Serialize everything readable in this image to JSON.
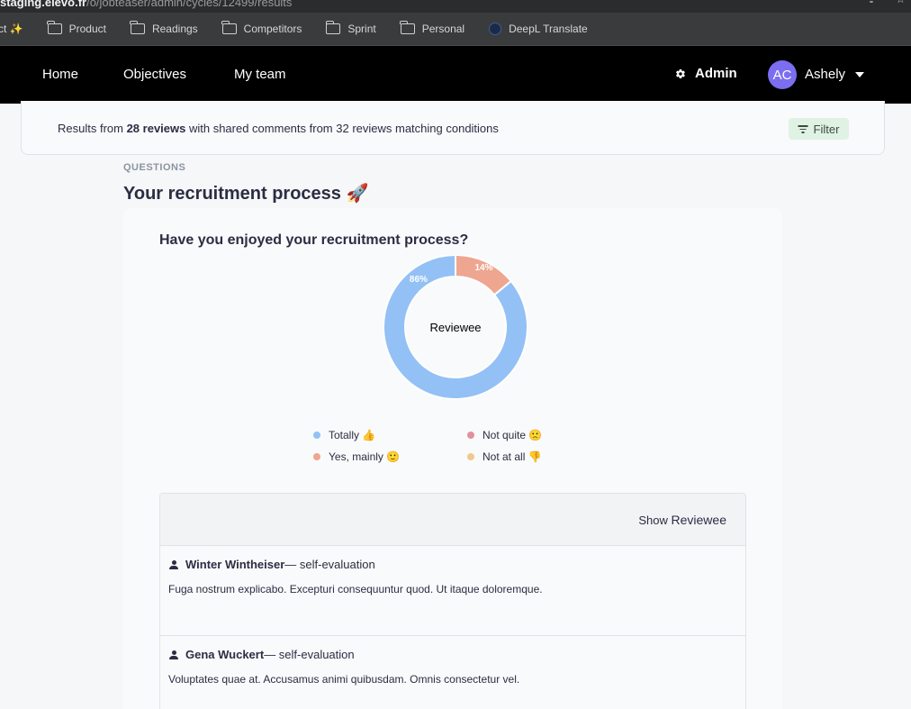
{
  "browser": {
    "url_host": "staging.elevo.fr",
    "url_path": "/o/jobteaser/admin/cycles/12499/results",
    "bookmarks": [
      {
        "label": "ct ✨",
        "icon": "sparkle"
      },
      {
        "label": "Product",
        "icon": "folder-icon"
      },
      {
        "label": "Readings",
        "icon": "folder-icon"
      },
      {
        "label": "Competitors",
        "icon": "folder-icon"
      },
      {
        "label": "Sprint",
        "icon": "folder-icon"
      },
      {
        "label": "Personal",
        "icon": "folder-icon"
      },
      {
        "label": "DeepL Translate",
        "icon": "deepl-icon"
      }
    ]
  },
  "nav": {
    "home": "Home",
    "objectives": "Objectives",
    "my_team": "My team",
    "admin": "Admin",
    "avatar_initials": "AC",
    "user_name": "Ashely"
  },
  "banner": {
    "prefix": "Results from ",
    "reviews_count": "28 reviews",
    "suffix": " with shared comments from 32 reviews matching conditions",
    "filter_label": "Filter"
  },
  "section": {
    "label": "QUESTIONS",
    "title": "Your recruitment process 🚀"
  },
  "question": {
    "title": "Have you enjoyed your recruitment process?",
    "center_label": "Reviewee"
  },
  "chart_data": {
    "type": "pie",
    "categories": [
      "Totally 👍",
      "Yes, mainly 🙂",
      "Not quite 🙁",
      "Not at all 👎"
    ],
    "values": [
      86,
      14,
      0,
      0
    ],
    "value_labels": [
      "86%",
      "14%",
      "",
      ""
    ],
    "colors": [
      "#93c1f5",
      "#eea690",
      "#e38f9c",
      "#f2c88f"
    ],
    "center_label": "Reviewee"
  },
  "comments": {
    "show_prefix": "Show",
    "show_target": "Reviewee",
    "items": [
      {
        "author": "Winter Wintheiser",
        "kind": " — self-evaluation",
        "text": "Fuga nostrum explicabo. Excepturi consequuntur quod. Ut itaque doloremque."
      },
      {
        "author": "Gena Wuckert",
        "kind": " — self-evaluation",
        "text": "Voluptates quae at. Accusamus animi quibusdam. Omnis consectetur vel."
      }
    ]
  }
}
